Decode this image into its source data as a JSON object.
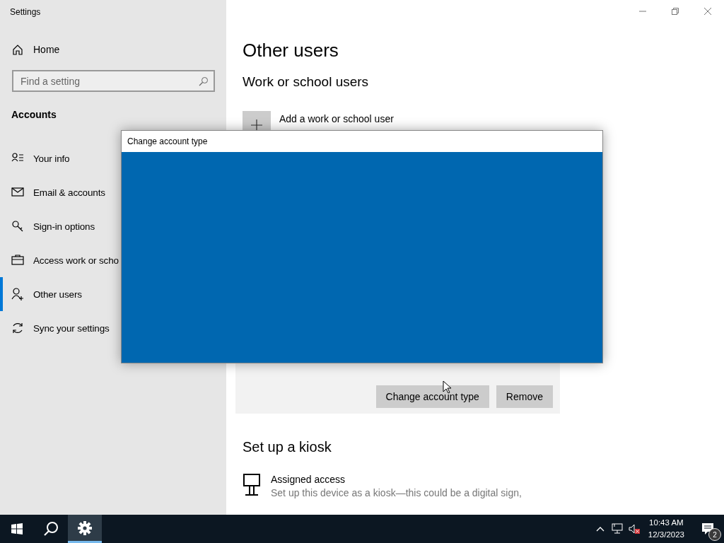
{
  "window": {
    "title": "Settings"
  },
  "sidebar": {
    "home": "Home",
    "search": {
      "placeholder": "Find a setting"
    },
    "section": "Accounts",
    "items": [
      {
        "label": "Your info",
        "selected": false
      },
      {
        "label": "Email & accounts",
        "selected": false
      },
      {
        "label": "Sign-in options",
        "selected": false
      },
      {
        "label": "Access work or scho",
        "selected": false
      },
      {
        "label": "Other users",
        "selected": true
      },
      {
        "label": "Sync your settings",
        "selected": false
      }
    ]
  },
  "main": {
    "title": "Other users",
    "work_heading": "Work or school users",
    "add_label": "Add a work or school user",
    "user": {
      "buttons": [
        "Change account type",
        "Remove"
      ]
    },
    "kiosk": {
      "heading": "Set up a kiosk",
      "item_title": "Assigned access",
      "item_description": "Set up this device as a kiosk—this could be a digital sign,"
    }
  },
  "dialog": {
    "title": "Change account type"
  },
  "taskbar": {
    "pinned": [
      {
        "kind": "settings",
        "selected": true
      }
    ],
    "volume_muted": true,
    "time": "10:43 AM",
    "date": "12/3/2023",
    "notification_count": "2"
  }
}
